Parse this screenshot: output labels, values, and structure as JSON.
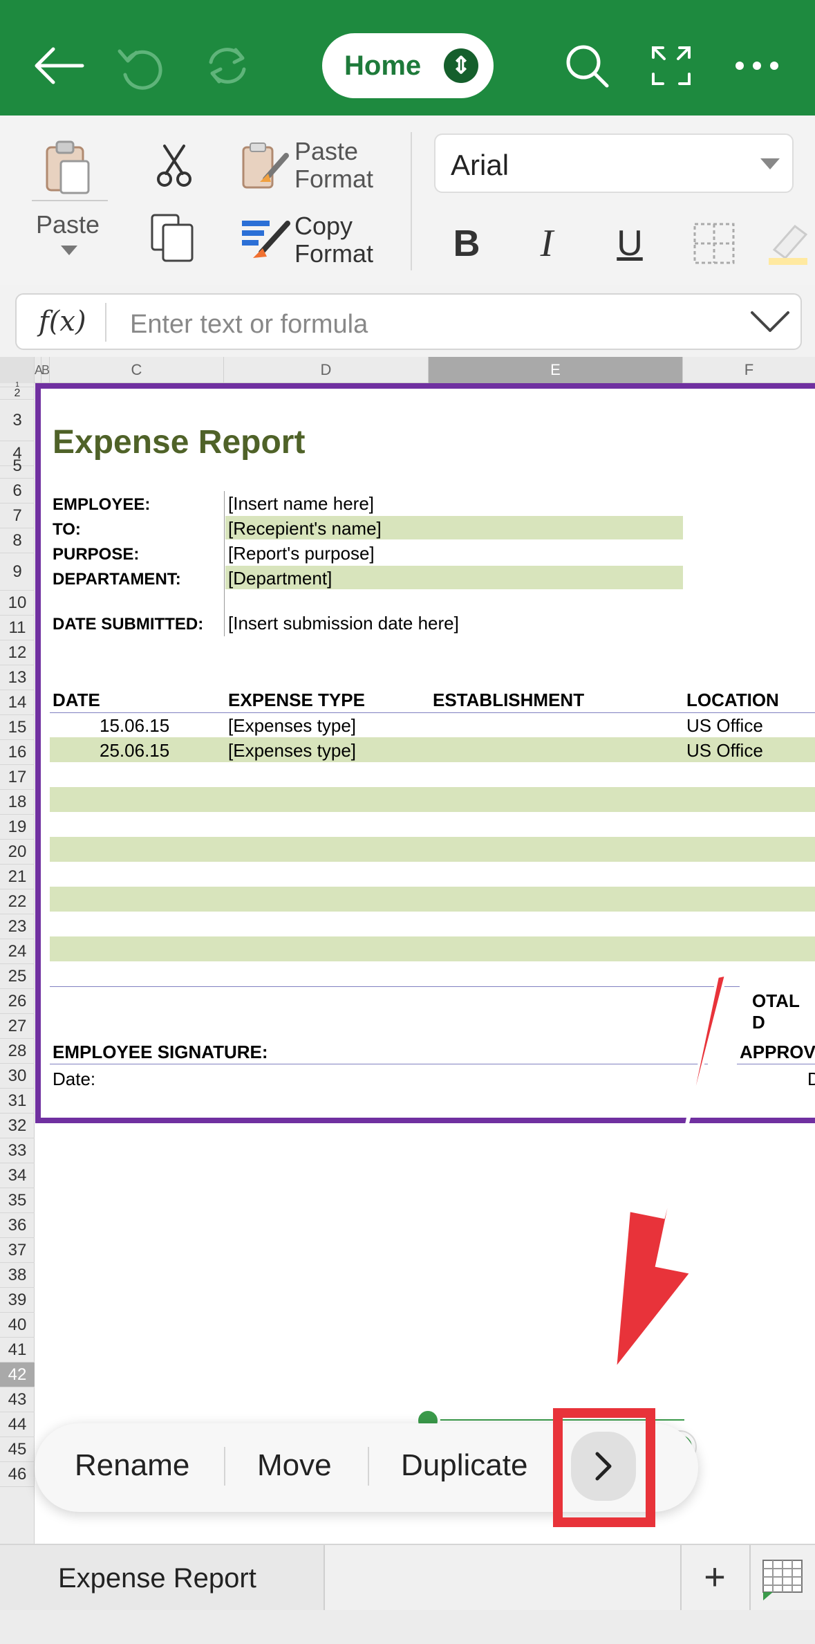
{
  "toolbar": {
    "home_label": "Home",
    "icons": [
      "back-arrow-icon",
      "undo-icon",
      "redo-icon",
      "search-icon",
      "fullscreen-icon",
      "more-icon"
    ]
  },
  "ribbon": {
    "paste_label": "Paste",
    "paste_format_line1": "Paste",
    "paste_format_line2": "Format",
    "copy_format_line1": "Copy",
    "copy_format_line2": "Format",
    "font_name": "Arial",
    "bold_label": "B",
    "italic_label": "I",
    "underline_label": "U"
  },
  "formula_bar": {
    "fx_label": "f(x)",
    "placeholder": "Enter text or formula"
  },
  "columns": [
    "A",
    "B",
    "C",
    "D",
    "E",
    "F"
  ],
  "rows": [
    "1",
    "2",
    "3",
    "4",
    "5",
    "6",
    "7",
    "8",
    "9",
    "10",
    "11",
    "12",
    "13",
    "14",
    "15",
    "16",
    "17",
    "18",
    "19",
    "20",
    "21",
    "22",
    "23",
    "24",
    "25",
    "26",
    "27",
    "28",
    "30",
    "31",
    "32",
    "33",
    "34",
    "35",
    "36",
    "37",
    "38",
    "39",
    "40",
    "41",
    "42",
    "43",
    "44",
    "45",
    "46"
  ],
  "report": {
    "title": "Expense Report",
    "employee_label": "EMPLOYEE:",
    "employee_value": "[Insert name here]",
    "to_label": "TO:",
    "to_value": "[Recepient's name]",
    "purpose_label": "PURPOSE:",
    "purpose_value": "[Report's purpose]",
    "department_label": "DEPARTAMENT:",
    "department_value": "[Department]",
    "date_submitted_label": "DATE SUBMITTED:",
    "date_submitted_value": "[Insert submission date here]",
    "table_headers": [
      "DATE",
      "EXPENSE TYPE",
      "ESTABLISHMENT",
      "LOCATION"
    ],
    "table_rows": [
      {
        "date": "15.06.15",
        "type": "[Expenses type]",
        "location": "US Office"
      },
      {
        "date": "25.06.15",
        "type": "[Expenses type]",
        "location": "US Office"
      }
    ],
    "total_label": "OTAL D",
    "signature_label": "EMPLOYEE SIGNATURE:",
    "approval_label": "APPROV",
    "date_label": "Date:",
    "date_cut": "D"
  },
  "popup": {
    "rename": "Rename",
    "move": "Move",
    "duplicate": "Duplicate"
  },
  "tabs": {
    "sheet_name": "Expense Report",
    "add_label": "+"
  },
  "colors": {
    "ribbon_green": "#1e8a3f",
    "title_olive": "#4f6228",
    "band_green": "#d8e4bc",
    "border_purple": "#7030a0",
    "highlight_red": "#e8333a"
  }
}
